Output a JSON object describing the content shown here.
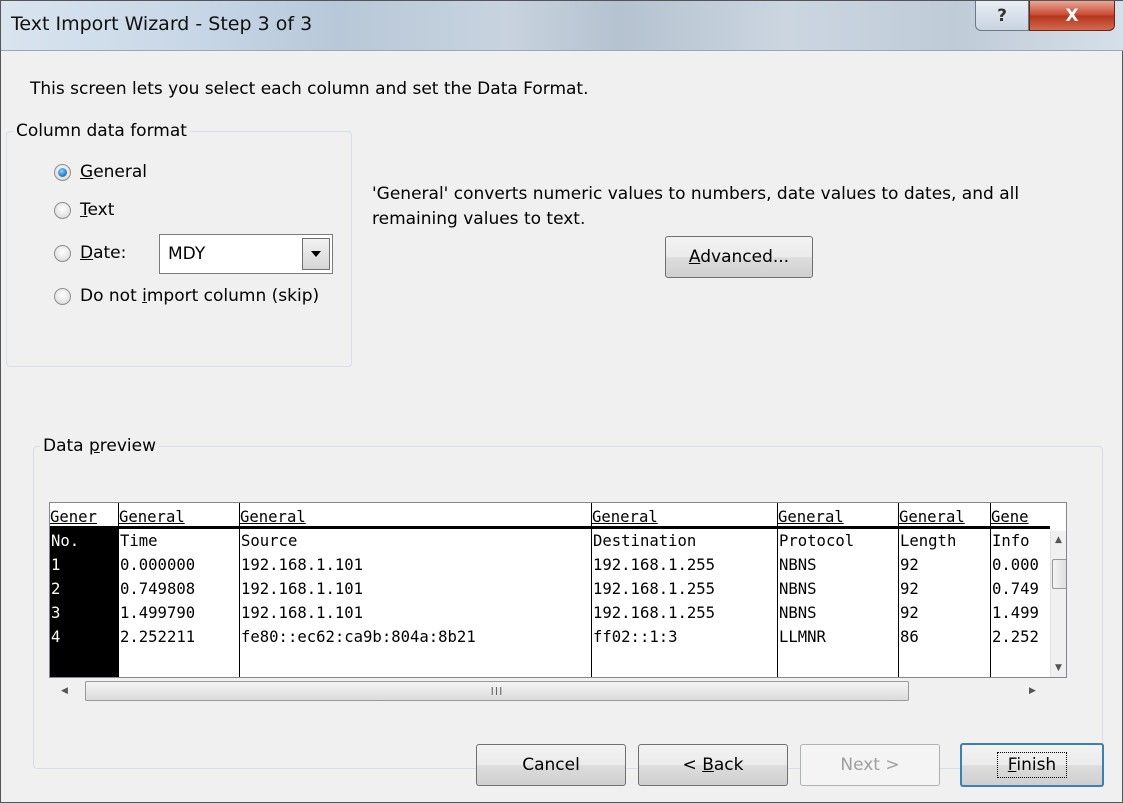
{
  "window": {
    "title": "Text Import Wizard - Step 3 of 3",
    "help_glyph": "?",
    "close_glyph": "X"
  },
  "intro_text": "This screen lets you select each column and set the Data Format.",
  "column_format": {
    "legend": "Column data format",
    "options": [
      {
        "pre": "",
        "key": "G",
        "post": "eneral",
        "selected": true
      },
      {
        "pre": "",
        "key": "T",
        "post": "ext",
        "selected": false
      },
      {
        "pre": "",
        "key": "D",
        "post": "ate:",
        "selected": false
      },
      {
        "pre": "Do not ",
        "key": "i",
        "post": "mport column (skip)",
        "selected": false
      }
    ],
    "date_value": "MDY"
  },
  "description": {
    "line1": "'General' converts numeric values to numbers, date values to dates, and all",
    "line2": "remaining values to text."
  },
  "advanced_button": {
    "key": "A",
    "rest": "dvanced..."
  },
  "preview": {
    "legend_pre": "Data ",
    "legend_key": "p",
    "legend_post": "review",
    "columns": [
      {
        "header": "Gener",
        "cells": [
          "No.",
          "1",
          "2",
          "3",
          "4"
        ]
      },
      {
        "header": "General",
        "cells": [
          "Time",
          "0.000000",
          "0.749808",
          "1.499790",
          "2.252211"
        ]
      },
      {
        "header": "General",
        "cells": [
          "Source",
          "192.168.1.101",
          "192.168.1.101",
          "192.168.1.101",
          "fe80::ec62:ca9b:804a:8b21"
        ]
      },
      {
        "header": "General",
        "cells": [
          "Destination",
          "192.168.1.255",
          "192.168.1.255",
          "192.168.1.255",
          "ff02::1:3"
        ]
      },
      {
        "header": "General",
        "cells": [
          "Protocol",
          "NBNS",
          "NBNS",
          "NBNS",
          "LLMNR"
        ]
      },
      {
        "header": "General",
        "cells": [
          "Length",
          "92",
          "92",
          "92",
          "86"
        ]
      },
      {
        "header": "Gene",
        "cells": [
          "Info",
          "0.000",
          "0.749",
          "1.499",
          "2.252"
        ]
      }
    ],
    "hscroll_grip": "III"
  },
  "buttons": {
    "cancel": "Cancel",
    "back_pre": "< ",
    "back_key": "B",
    "back_post": "ack",
    "next": "Next >",
    "finish_key": "F",
    "finish_post": "inish"
  },
  "colors": {
    "accent_radio": "#2d7fc6",
    "default_button_border": "#3c7fb1",
    "close_button": "#c8452e"
  }
}
